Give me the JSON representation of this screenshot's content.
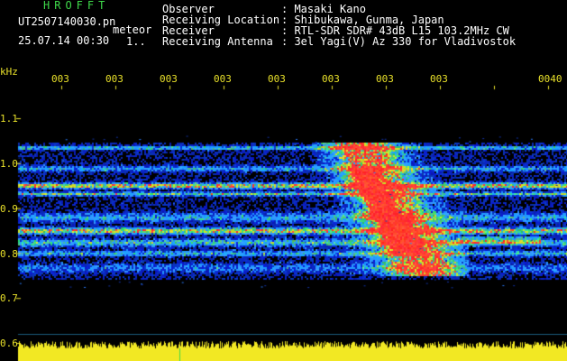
{
  "header": {
    "logo": "HROFFT",
    "filename": "UT2507140030.pn",
    "filename_suffix": "meteor",
    "datetime": "25.07.14 00:30",
    "dots": "1..",
    "meta": [
      {
        "key": "Observer",
        "value": ": Masaki Kano"
      },
      {
        "key": "Receiving Location",
        "value": ": Shibukawa, Gunma, Japan"
      },
      {
        "key": "Receiver",
        "value": ": RTL-SDR SDR# 43dB L15 103.2MHz CW"
      },
      {
        "key": "Receiving Antenna",
        "value": ": 3el Yagi(V) Az 330 for Vladivostok"
      }
    ]
  },
  "spectrogram": {
    "unit_label": "kHz",
    "x_tick_labels": [
      "003",
      "003",
      "003",
      "003",
      "003",
      "003",
      "003",
      "003",
      "0040"
    ],
    "y_tick_labels": [
      "1.1",
      "1.0",
      "0.9",
      "0.8",
      "0.7",
      "0.6"
    ],
    "colors": {
      "background": "#000000",
      "noise_low": "#0a1a8a",
      "noise_mid": "#2a6dff",
      "signal_green": "#35d24a",
      "signal_red": "#ff2a2a",
      "tick_color": "#e8e02a"
    }
  }
}
